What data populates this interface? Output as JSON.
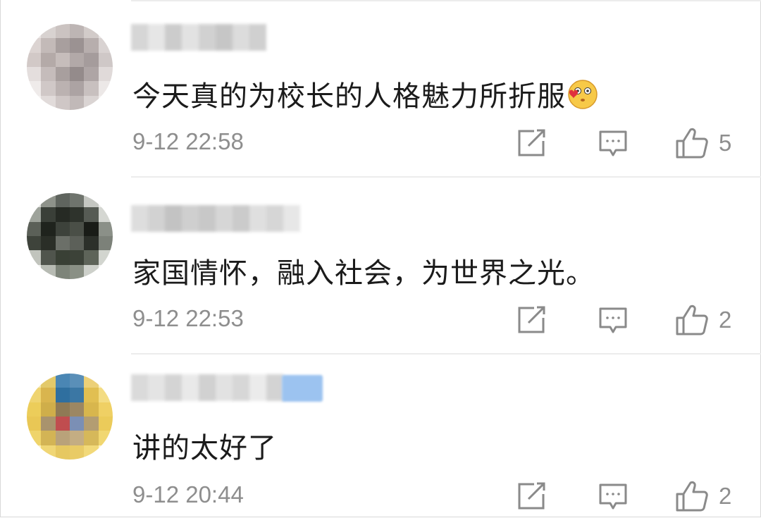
{
  "comments": [
    {
      "text": "今天真的为校长的人格魅力所折服",
      "emoji": "smiling-face-with-heart-emoji",
      "timestamp": "9-12 22:58",
      "likes": "5"
    },
    {
      "text": "家国情怀，融入社会，为世界之光。",
      "timestamp": "9-12 22:53",
      "likes": "2"
    },
    {
      "text": "讲的太好了",
      "timestamp": "9-12 20:44",
      "likes": "2"
    }
  ],
  "icons": {
    "share": "share-icon",
    "reply": "reply-icon",
    "like": "thumbs-up-icon"
  },
  "colors": {
    "text": "#1b1b1b",
    "meta": "#8e8e8e",
    "icon": "#8a8a8a",
    "divider": "#ececec",
    "badge": "#9cc3f0"
  }
}
